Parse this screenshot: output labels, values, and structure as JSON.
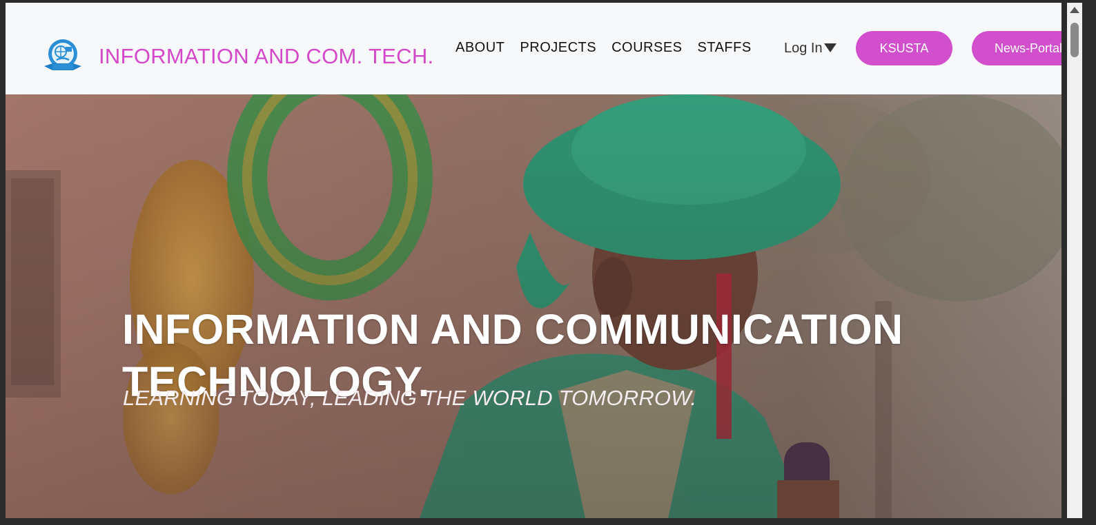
{
  "brand": {
    "title": "INFORMATION AND COM. TECH.",
    "logo_icon": "ict-crest-logo"
  },
  "nav": {
    "links": [
      "ABOUT",
      "PROJECTS",
      "COURSES",
      "STAFFS"
    ],
    "login_label": "Log In",
    "buttons": {
      "ksusta": "KSUSTA",
      "news_portal": "News-Portal"
    }
  },
  "hero": {
    "title": "INFORMATION AND COMMUNICATION TECHNOLOGY.",
    "subtitle": "LEARNING TODAY, LEADING THE WORLD TOMORROW."
  },
  "colors": {
    "brand_accent": "#d447c9",
    "button_bg": "#d14fcc",
    "navbar_bg": "#f7f8fa"
  }
}
